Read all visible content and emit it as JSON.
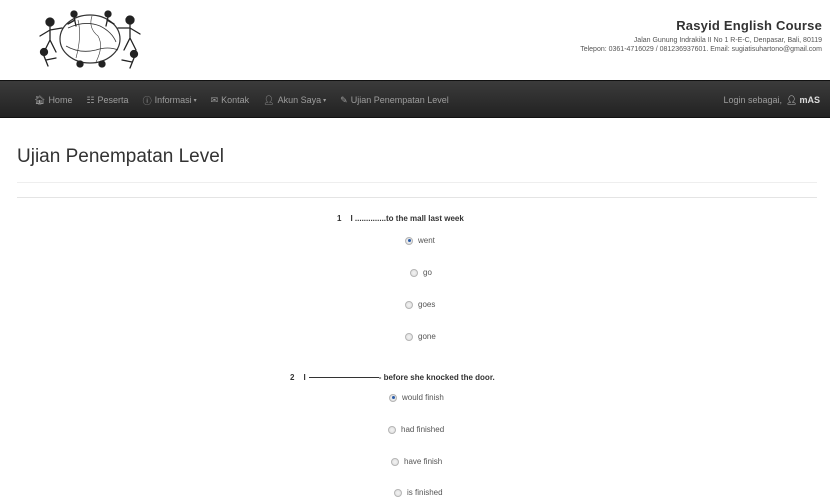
{
  "brand": {
    "title": "Rasyid English Course",
    "address": "Jalan Gunung Indrakila II No 1 R-E-C, Denpasar, Bali, 80119",
    "contact": "Telepon: 0361-4716029 / 081236937601. Email: sugiatisuhartono@gmail.com"
  },
  "nav": {
    "items": [
      {
        "label": "Home",
        "icon": "home-icon",
        "glyph": "🏠︎",
        "dropdown": false
      },
      {
        "label": "Peserta",
        "icon": "list-icon",
        "glyph": "☷",
        "dropdown": false
      },
      {
        "label": "Informasi",
        "icon": "info-icon",
        "glyph": "ⓘ",
        "dropdown": true
      },
      {
        "label": "Kontak",
        "icon": "envelope-icon",
        "glyph": "✉",
        "dropdown": false
      },
      {
        "label": "Akun Saya",
        "icon": "user-icon",
        "glyph": "👤︎",
        "dropdown": true
      },
      {
        "label": "Ujian Penempatan Level",
        "icon": "edit-icon",
        "glyph": "✎",
        "dropdown": false
      }
    ],
    "login_prefix": "Login sebagai,",
    "username": "mAS"
  },
  "page": {
    "title": "Ujian Penempatan Level"
  },
  "questions": [
    {
      "number": "1",
      "text_before": "I ..............to the mall last week",
      "text_after": "",
      "options": [
        {
          "label": "went",
          "selected": true
        },
        {
          "label": "go",
          "selected": false
        },
        {
          "label": "goes",
          "selected": false
        },
        {
          "label": "gone",
          "selected": false
        }
      ]
    },
    {
      "number": "2",
      "text_before": "I",
      "text_after": "- before she knocked the door.",
      "options": [
        {
          "label": "would finish",
          "selected": true
        },
        {
          "label": "had finished",
          "selected": false
        },
        {
          "label": "have finish",
          "selected": false
        },
        {
          "label": "is finished",
          "selected": false
        }
      ]
    }
  ]
}
